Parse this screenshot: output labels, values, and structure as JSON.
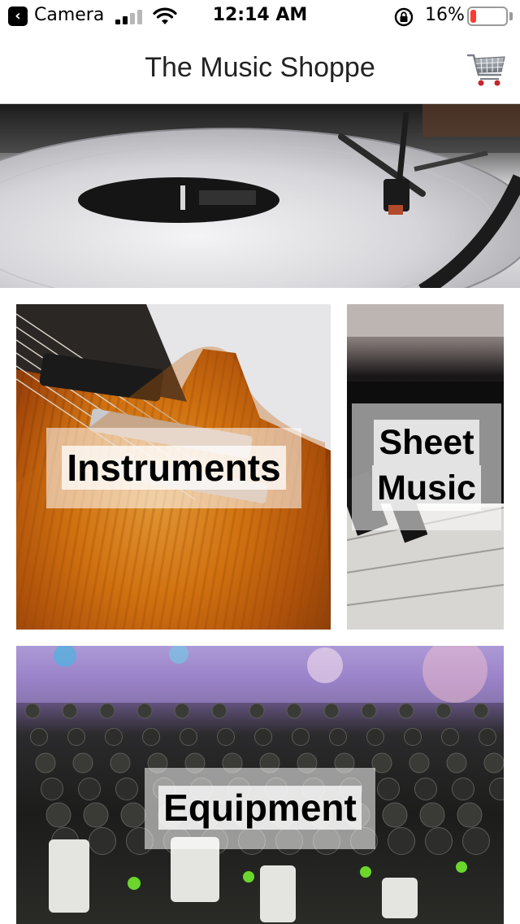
{
  "status_bar": {
    "back_app": "Camera",
    "time": "12:14 AM",
    "battery_percent": "16%",
    "battery_level": 0.16,
    "battery_color": "#ff3b30",
    "signal_bars_filled": 2,
    "signal_bars_total": 4
  },
  "nav": {
    "title": "The Music Shoppe",
    "cart_icon": "shopping-cart-icon"
  },
  "hero": {
    "image": "turntable-record-photo"
  },
  "categories": [
    {
      "label": "Instruments",
      "image": "electric-guitar-photo"
    },
    {
      "label_line1": "Sheet",
      "label_line2": "Music",
      "image": "piano-keys-photo"
    },
    {
      "label": "Equipment",
      "image": "mixing-console-photo"
    }
  ]
}
